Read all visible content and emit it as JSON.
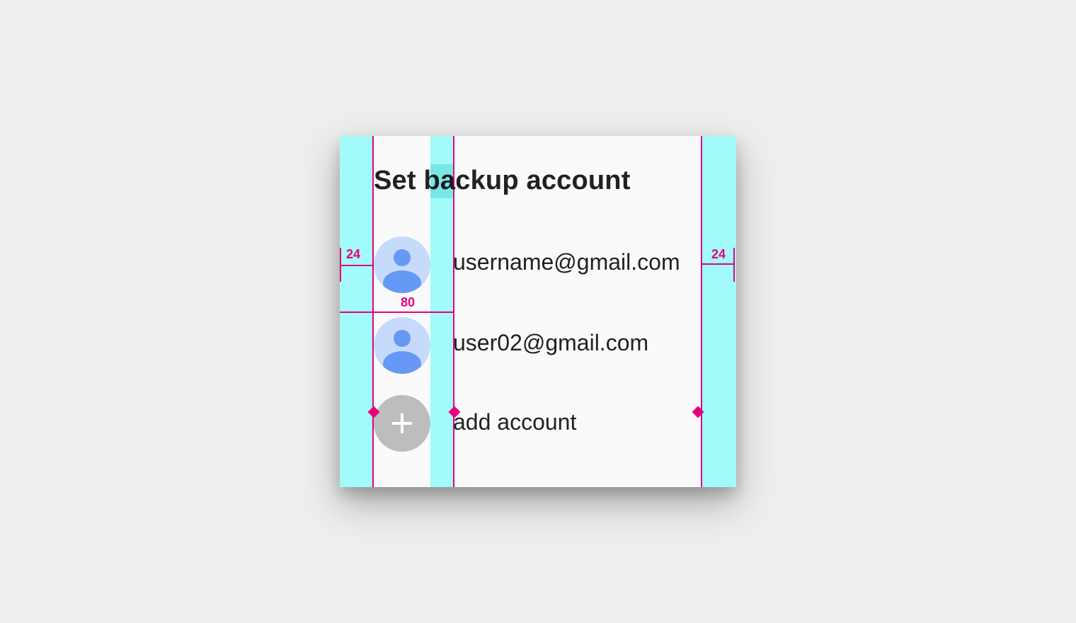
{
  "dialog": {
    "title": "Set backup account",
    "accounts": [
      {
        "email": "username@gmail.com",
        "icon": "account-avatar-icon"
      },
      {
        "email": "user02@gmail.com",
        "icon": "account-avatar-icon"
      }
    ],
    "add_account": {
      "label": "add account",
      "icon": "plus-icon"
    }
  },
  "spec_overlay": {
    "left_margin_label": "24",
    "right_margin_label": "24",
    "avatar_column_label": "80",
    "accent_color": "#e6007e",
    "column_color": "#a2fbf8"
  },
  "colors": {
    "background": "#eeeeee",
    "dialog_surface": "#fafafa",
    "avatar_bg": "#c6dafb",
    "avatar_fg": "#6699f5",
    "add_button_bg": "#bdbdbd"
  }
}
